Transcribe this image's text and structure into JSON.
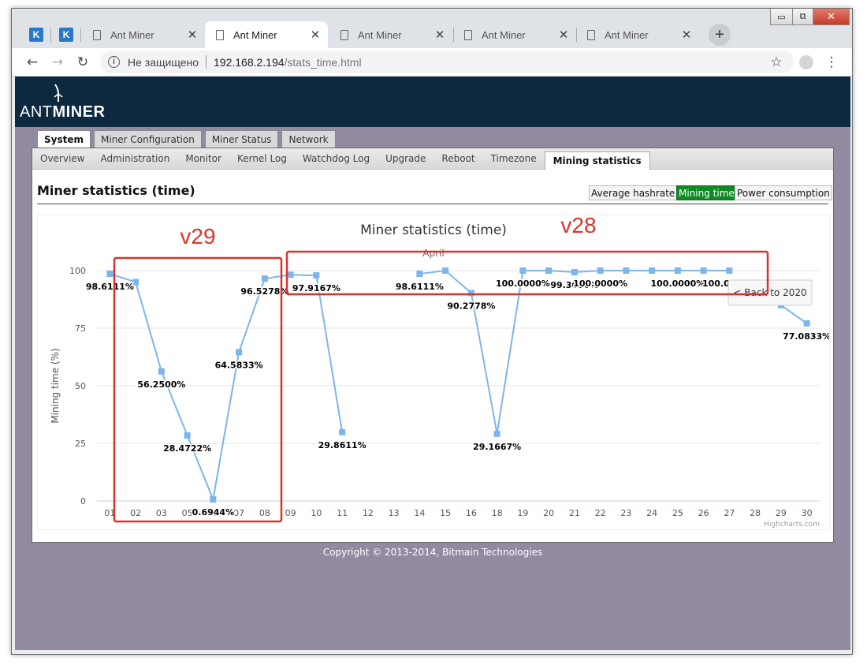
{
  "browser": {
    "tabs": [
      {
        "title": "Ant Miner"
      },
      {
        "title": "Ant Miner"
      },
      {
        "title": "Ant Miner"
      },
      {
        "title": "Ant Miner"
      },
      {
        "title": "Ant Miner"
      }
    ],
    "fav_tab_glyph": "K",
    "new_tab": "+",
    "close_glyph": "✕",
    "window_controls": {
      "minimize": "▭",
      "restore": "⧉",
      "close": "✕"
    },
    "address": {
      "security_label": "Не защищено",
      "host": "192.168.2.194",
      "path": "/stats_time.html"
    }
  },
  "app": {
    "logo_prefix": "ANT",
    "logo_suffix": "MINER",
    "main_tabs": [
      "System",
      "Miner Configuration",
      "Miner Status",
      "Network"
    ],
    "sub_tabs": [
      "Overview",
      "Administration",
      "Monitor",
      "Kernel Log",
      "Watchdog Log",
      "Upgrade",
      "Reboot",
      "Timezone",
      "Mining statistics"
    ],
    "page_title": "Miner statistics (time)",
    "buttons": {
      "avg_hashrate": "Average hashrate",
      "mining_time": "Mining time",
      "power": "Power consumption"
    },
    "copyright": "Copyright © 2013-2014, Bitmain Technologies"
  },
  "chart_data": {
    "type": "line",
    "title": "Miner statistics (time)",
    "subtitle": "April",
    "ylabel": "Mining time (%)",
    "xlabel": "",
    "ylim": [
      0,
      100
    ],
    "yticks": [
      0,
      25,
      50,
      75,
      100
    ],
    "categories": [
      "01",
      "02",
      "03",
      "05",
      "06",
      "07",
      "08",
      "09",
      "10",
      "11",
      "12",
      "13",
      "14",
      "15",
      "16",
      "18",
      "19",
      "20",
      "21",
      "22",
      "23",
      "24",
      "25",
      "26",
      "27",
      "28",
      "29",
      "30"
    ],
    "series": [
      {
        "values": [
          98.6111,
          95,
          56.25,
          28.4722,
          0.6944,
          64.5833,
          96.5278,
          98.2,
          97.9167,
          29.8611,
          null,
          null,
          98.6111,
          100,
          90.2778,
          29.1667,
          100,
          100,
          99.3056,
          100,
          100,
          100,
          100,
          100,
          100,
          null,
          85,
          77.0833
        ]
      }
    ],
    "data_labels": [
      {
        "index": 0,
        "text": "98.6111%"
      },
      {
        "index": 2,
        "text": "56.2500%"
      },
      {
        "index": 3,
        "text": "28.4722%"
      },
      {
        "index": 4,
        "text": "0.6944%"
      },
      {
        "index": 5,
        "text": "64.5833%"
      },
      {
        "index": 6,
        "text": "96.5278%"
      },
      {
        "index": 8,
        "text": "97.9167%"
      },
      {
        "index": 9,
        "text": "29.8611%"
      },
      {
        "index": 12,
        "text": "98.6111%"
      },
      {
        "index": 14,
        "text": "90.2778%"
      },
      {
        "index": 15,
        "text": "29.1667%"
      },
      {
        "index": 16,
        "text": "100.0000%"
      },
      {
        "index": 18,
        "text": "99.3056%"
      },
      {
        "index": 19,
        "text": "100.0000%"
      },
      {
        "index": 22,
        "text": "100.0000%"
      },
      {
        "index": 24,
        "text": "100.0000%"
      },
      {
        "index": 27,
        "text": "77.0833%"
      }
    ],
    "back_button": "< Back to 2020",
    "credit": "Highcharts.com",
    "grid": true,
    "colors": {
      "line": "#7cb5ec",
      "grid": "#e6e6e6"
    }
  },
  "annotations": {
    "left_label": "v29",
    "right_label": "v28",
    "color": "#d9342b"
  }
}
